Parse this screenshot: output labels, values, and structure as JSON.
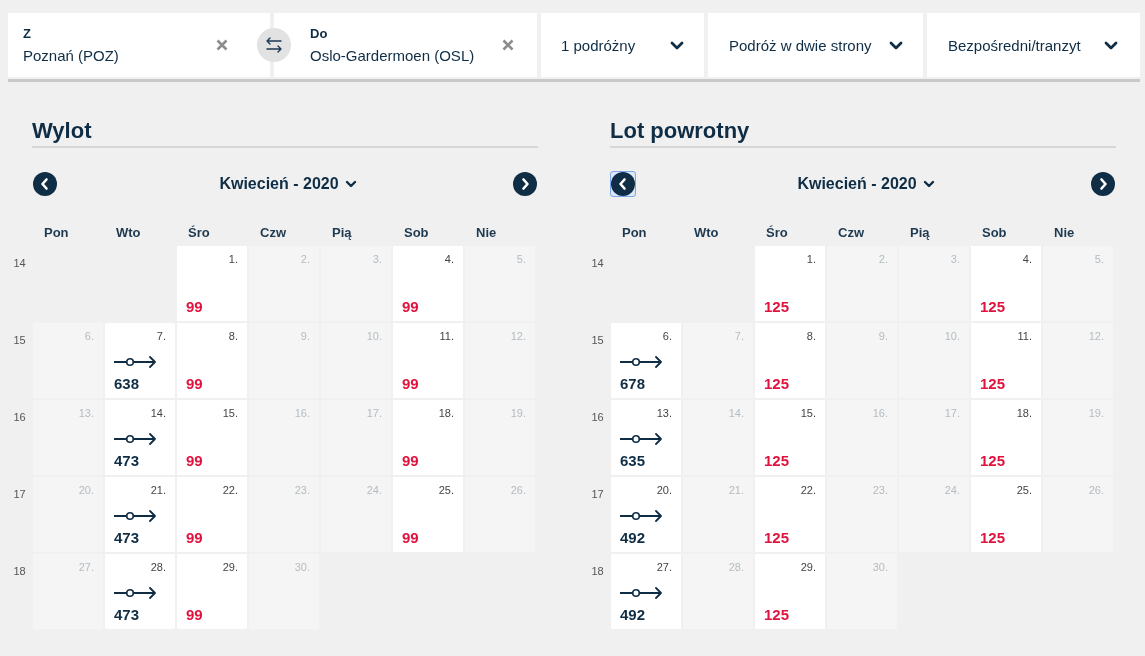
{
  "search_bar": {
    "origin": {
      "label": "Z",
      "value": "Poznań (POZ)"
    },
    "destination": {
      "label": "Do",
      "value": "Oslo-Gardermoen (OSL)"
    },
    "dropdowns": [
      {
        "value": "1 podróżny"
      },
      {
        "value": "Podróż w dwie strony"
      },
      {
        "value": "Bezpośredni/tranzyt"
      }
    ]
  },
  "calendars": [
    {
      "title": "Wylot",
      "month": "Kwiecień - 2020",
      "prev_button": {
        "focused": false
      },
      "weekdays": [
        "Pon",
        "Wto",
        "Śro",
        "Czw",
        "Pią",
        "Sob",
        "Nie"
      ],
      "weeks": [
        {
          "number": "14",
          "days": [
            {
              "date": "1.",
              "kind": "direct",
              "price": "99"
            },
            {
              "date": "2.",
              "kind": "unavailable"
            },
            {
              "date": "3.",
              "kind": "unavailable"
            },
            {
              "date": "4.",
              "kind": "direct",
              "price": "99"
            },
            {
              "date": "5.",
              "kind": "unavailable"
            }
          ]
        },
        {
          "number": "15",
          "days": [
            {
              "date": "6.",
              "kind": "unavailable"
            },
            {
              "date": "7.",
              "kind": "transit",
              "price": "638"
            },
            {
              "date": "8.",
              "kind": "direct",
              "price": "99"
            },
            {
              "date": "9.",
              "kind": "unavailable"
            },
            {
              "date": "10.",
              "kind": "unavailable"
            },
            {
              "date": "11.",
              "kind": "direct",
              "price": "99"
            },
            {
              "date": "12.",
              "kind": "unavailable"
            }
          ]
        },
        {
          "number": "16",
          "days": [
            {
              "date": "13.",
              "kind": "unavailable"
            },
            {
              "date": "14.",
              "kind": "transit",
              "price": "473"
            },
            {
              "date": "15.",
              "kind": "direct",
              "price": "99"
            },
            {
              "date": "16.",
              "kind": "unavailable"
            },
            {
              "date": "17.",
              "kind": "unavailable"
            },
            {
              "date": "18.",
              "kind": "direct",
              "price": "99"
            },
            {
              "date": "19.",
              "kind": "unavailable"
            }
          ]
        },
        {
          "number": "17",
          "days": [
            {
              "date": "20.",
              "kind": "unavailable"
            },
            {
              "date": "21.",
              "kind": "transit",
              "price": "473"
            },
            {
              "date": "22.",
              "kind": "direct",
              "price": "99"
            },
            {
              "date": "23.",
              "kind": "unavailable"
            },
            {
              "date": "24.",
              "kind": "unavailable"
            },
            {
              "date": "25.",
              "kind": "direct",
              "price": "99"
            },
            {
              "date": "26.",
              "kind": "unavailable"
            }
          ]
        },
        {
          "number": "18",
          "days": [
            {
              "date": "27.",
              "kind": "unavailable"
            },
            {
              "date": "28.",
              "kind": "transit",
              "price": "473"
            },
            {
              "date": "29.",
              "kind": "direct",
              "price": "99"
            },
            {
              "date": "30.",
              "kind": "unavailable"
            }
          ]
        }
      ]
    },
    {
      "title": "Lot powrotny",
      "month": "Kwiecień - 2020",
      "prev_button": {
        "focused": true
      },
      "weekdays": [
        "Pon",
        "Wto",
        "Śro",
        "Czw",
        "Pią",
        "Sob",
        "Nie"
      ],
      "weeks": [
        {
          "number": "14",
          "days": [
            {
              "date": "1.",
              "kind": "direct",
              "price": "125"
            },
            {
              "date": "2.",
              "kind": "unavailable"
            },
            {
              "date": "3.",
              "kind": "unavailable"
            },
            {
              "date": "4.",
              "kind": "direct",
              "price": "125"
            },
            {
              "date": "5.",
              "kind": "unavailable"
            }
          ]
        },
        {
          "number": "15",
          "days": [
            {
              "date": "6.",
              "kind": "transit",
              "price": "678"
            },
            {
              "date": "7.",
              "kind": "unavailable"
            },
            {
              "date": "8.",
              "kind": "direct",
              "price": "125"
            },
            {
              "date": "9.",
              "kind": "unavailable"
            },
            {
              "date": "10.",
              "kind": "unavailable"
            },
            {
              "date": "11.",
              "kind": "direct",
              "price": "125"
            },
            {
              "date": "12.",
              "kind": "unavailable"
            }
          ]
        },
        {
          "number": "16",
          "days": [
            {
              "date": "13.",
              "kind": "transit",
              "price": "635"
            },
            {
              "date": "14.",
              "kind": "unavailable"
            },
            {
              "date": "15.",
              "kind": "direct",
              "price": "125"
            },
            {
              "date": "16.",
              "kind": "unavailable"
            },
            {
              "date": "17.",
              "kind": "unavailable"
            },
            {
              "date": "18.",
              "kind": "direct",
              "price": "125"
            },
            {
              "date": "19.",
              "kind": "unavailable"
            }
          ]
        },
        {
          "number": "17",
          "days": [
            {
              "date": "20.",
              "kind": "transit",
              "price": "492"
            },
            {
              "date": "21.",
              "kind": "unavailable"
            },
            {
              "date": "22.",
              "kind": "direct",
              "price": "125"
            },
            {
              "date": "23.",
              "kind": "unavailable"
            },
            {
              "date": "24.",
              "kind": "unavailable"
            },
            {
              "date": "25.",
              "kind": "direct",
              "price": "125"
            },
            {
              "date": "26.",
              "kind": "unavailable"
            }
          ]
        },
        {
          "number": "18",
          "days": [
            {
              "date": "27.",
              "kind": "transit",
              "price": "492"
            },
            {
              "date": "28.",
              "kind": "unavailable"
            },
            {
              "date": "29.",
              "kind": "direct",
              "price": "125"
            },
            {
              "date": "30.",
              "kind": "unavailable"
            }
          ]
        }
      ]
    }
  ]
}
